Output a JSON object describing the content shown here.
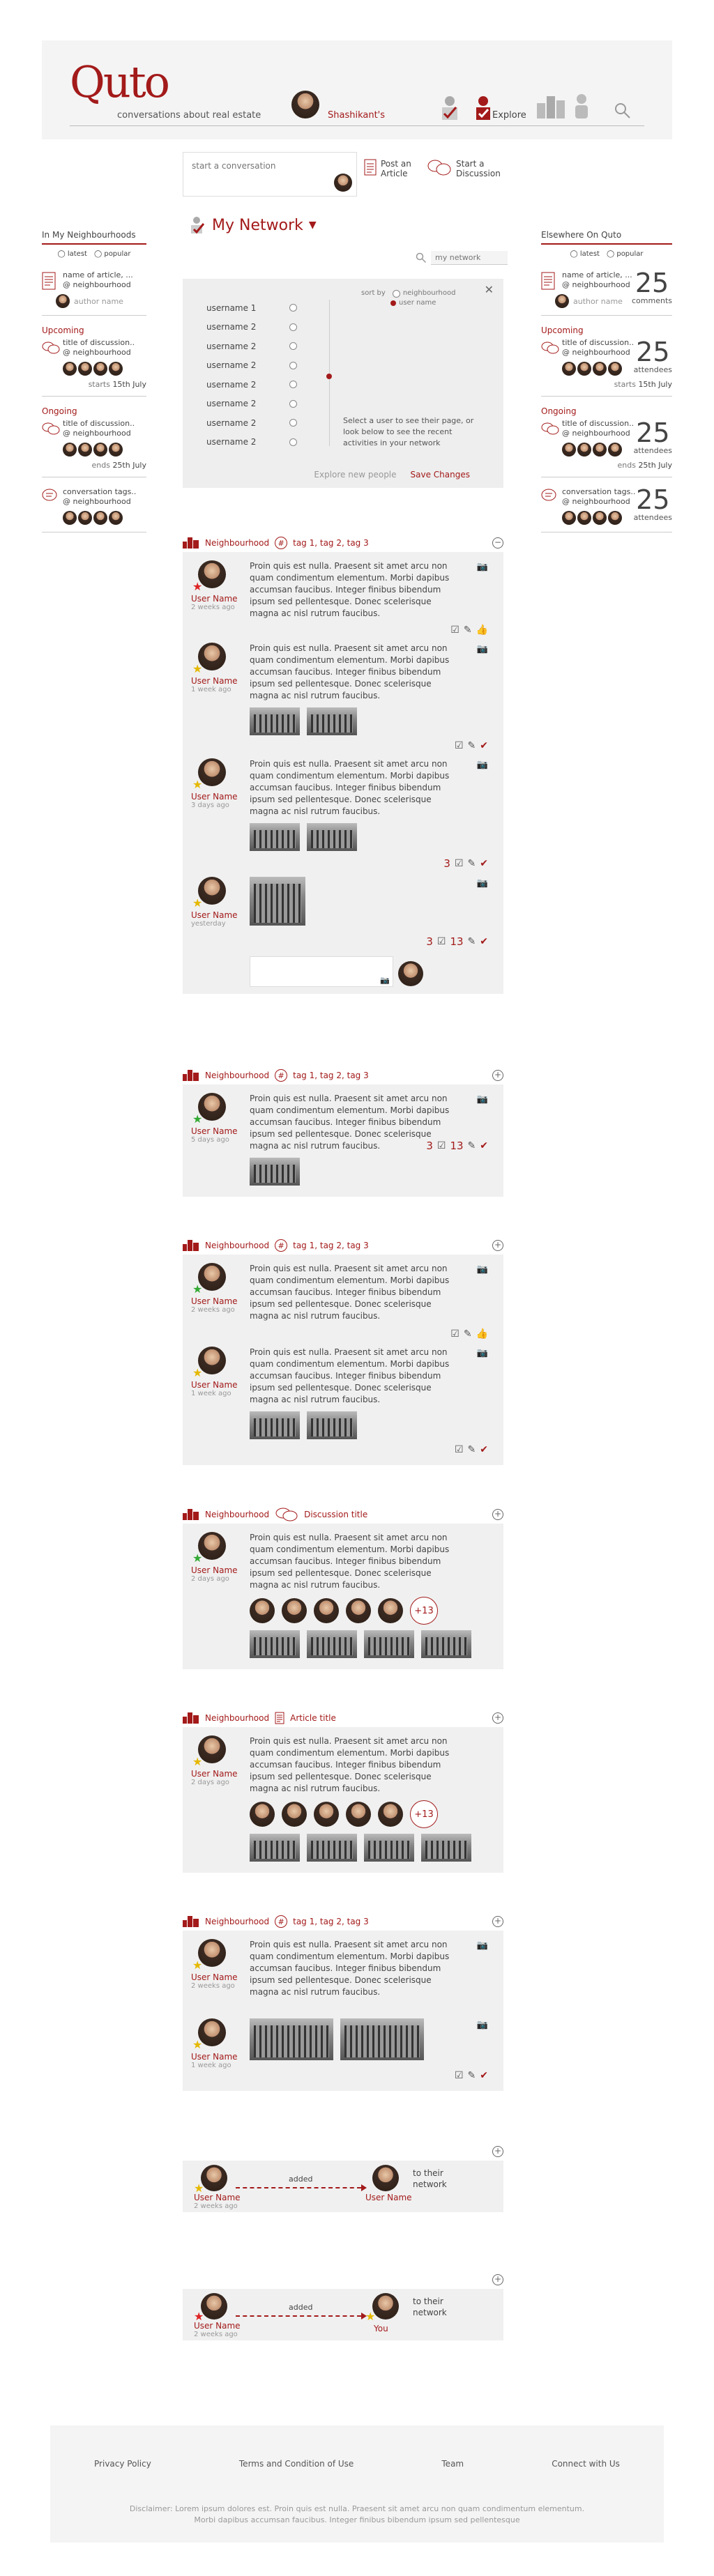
{
  "header": {
    "logo": "Quto",
    "tagline": "conversations about real estate",
    "user_name": "Shashikant's",
    "explore": "Explore"
  },
  "composer": {
    "placeholder": "start a conversation",
    "post_article": "Post an Article",
    "start_discussion": "Start a Discussion"
  },
  "network": {
    "title": "My Network",
    "search_placeholder": "my network",
    "sort_by": "sort by",
    "sort_options": [
      "neighbourhood",
      "user name"
    ],
    "users": [
      "username 1",
      "username 2",
      "username 2",
      "username 2",
      "username 2",
      "username 2",
      "username 2",
      "username 2"
    ],
    "hint": "Select a user to see their page, or look below to see the recent activities in your network",
    "explore_link": "Explore new people",
    "save_link": "Save Changes"
  },
  "left": {
    "title": "In My Neighbourhoods",
    "sort": [
      "latest",
      "popular"
    ],
    "article": {
      "name": "name of article, ...",
      "place": "@ neighbourhood",
      "author": "author name"
    },
    "upcoming": {
      "label": "Upcoming",
      "title": "title of discussion..",
      "place": "@ neighbourhood",
      "starts": "starts",
      "date": "15th July"
    },
    "ongoing": {
      "label": "Ongoing",
      "title": "title of discussion..",
      "place": "@ neighbourhood",
      "ends": "ends",
      "date": "25th July"
    },
    "conversation": {
      "title": "conversation tags..",
      "place": "@ neighbourhood"
    }
  },
  "right": {
    "title": "Elsewhere On Quto",
    "sort": [
      "latest",
      "popular"
    ],
    "article": {
      "name": "name of article, ...",
      "place": "@ neighbourhood",
      "author": "author name",
      "count": "25",
      "count_label": "comments"
    },
    "upcoming": {
      "label": "Upcoming",
      "title": "title of discussion..",
      "place": "@ neighbourhood",
      "starts": "starts",
      "date": "15th July",
      "count": "25",
      "count_label": "attendees"
    },
    "ongoing": {
      "label": "Ongoing",
      "title": "title of discussion..",
      "place": "@ neighbourhood",
      "ends": "ends",
      "date": "25th July",
      "count": "25",
      "count_label": "attendees"
    },
    "conversation": {
      "title": "conversation tags..",
      "place": "@ neighbourhood",
      "count": "25",
      "count_label": "attendees"
    }
  },
  "lorem": "Proin quis est nulla. Praesent sit amet arcu non quam condimentum elementum. Morbi dapibus accumsan faucibus. Integer finibus bibendum ipsum sed pellentesque. Donec scelerisque magna ac nisl rutrum faucibus.",
  "feed": {
    "neighbourhood": "Neighbourhood",
    "tags": "tag 1, tag 2, tag 3",
    "discussion_title": "Discussion title",
    "article_title": "Article title",
    "user": "User Name",
    "weeks2": "2 weeks ago",
    "week1": "1 week ago",
    "days3": "3 days ago",
    "yesterday": "yesterday",
    "days5": "5 days ago",
    "days2": "2 days ago",
    "count3": "3",
    "count13": "13",
    "plus": "+13",
    "added": "added",
    "to_network": "to their network",
    "you": "You"
  },
  "footer": {
    "links": [
      "Privacy Policy",
      "Terms and Condition of Use",
      "Team",
      "Connect with Us"
    ],
    "disclaimer": "Disclaimer: Lorem ipsum dolores est. Proin quis est nulla. Praesent sit amet arcu non quam condimentum elementum. Morbi dapibus accumsan faucibus. Integer finibus bibendum ipsum sed pellentesque"
  }
}
